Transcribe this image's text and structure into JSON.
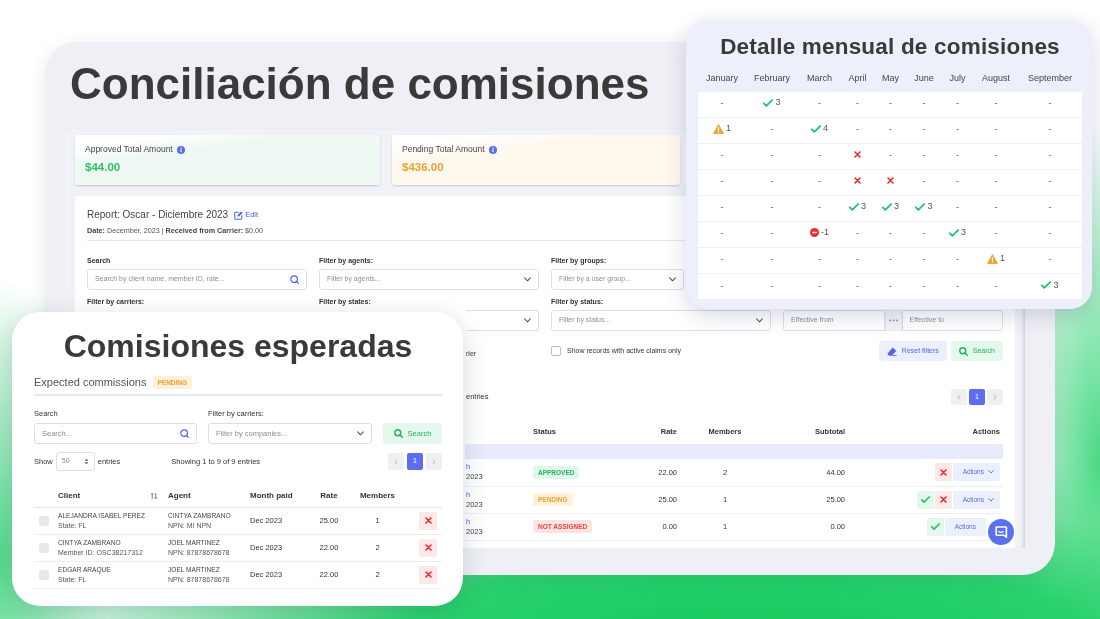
{
  "main_panel": {
    "title": "Conciliación de comisiones",
    "stat_cards": [
      {
        "label": "Approved Total Amount",
        "value": "$44.00",
        "kind": "approved"
      },
      {
        "label": "Pending Total Amount",
        "value": "$436.00",
        "kind": "pending"
      }
    ],
    "report": {
      "title": "Report: Oscar - Diciembre 2023",
      "edit_link": "Edit",
      "details": "**Date:** December, 2023 | **Received from Carrier:** $0.00"
    },
    "filter_rows": [
      [
        {
          "label": "Search",
          "kind": "search",
          "placeholder": "Search by client name, member ID, rate..."
        },
        {
          "label": "Filter by agents:",
          "kind": "select",
          "placeholder": "Filter by agents..."
        },
        {
          "label": "Filter by groups:",
          "kind": "select",
          "placeholder": "Filter by a user group..."
        }
      ],
      [
        {
          "label": "Filter by carriers:"
        },
        {
          "label": "Filter by states:",
          "kind": "select"
        },
        {
          "label": "Filter by status:",
          "kind": "select",
          "placeholder": "Filter by status..."
        },
        {
          "kind": "date_range",
          "from_placeholder": "Effective from",
          "to_placeholder": "Effective to"
        }
      ]
    ],
    "cut_option_label": "rier",
    "claims_checkbox": {
      "label": "Show records with active claims only",
      "checked": false
    },
    "buttons": [
      {
        "label": "Reset filters",
        "kind": "reset"
      },
      {
        "label": "Search",
        "kind": "search"
      }
    ],
    "cut_entries_text": "entries",
    "pages": [
      {
        "label": "1",
        "selected": true
      }
    ],
    "table": {
      "columns": [
        "Status",
        "Rate",
        "Members",
        "Subtotal",
        "Actions"
      ],
      "rows": [
        {
          "cut_client": "h",
          "cut_date": "2023",
          "status": {
            "label": "APPROVED",
            "kind": "approved"
          },
          "rate": "22.00",
          "members": "2",
          "subtotal": "44.00",
          "actions": [
            {
              "kind": "reject"
            }
          ],
          "menu": {
            "label": "Actions",
            "caret": true
          }
        },
        {
          "cut_client": "h",
          "cut_date": "2023",
          "status": {
            "label": "PENDING",
            "kind": "pending"
          },
          "rate": "25.00",
          "members": "1",
          "subtotal": "25.00",
          "actions": [
            {
              "kind": "approve"
            },
            {
              "kind": "reject"
            }
          ],
          "menu": {
            "label": "Actions",
            "caret": true
          }
        },
        {
          "cut_client": "h",
          "cut_date": "2023",
          "status": {
            "label": "NOT ASSIGNED",
            "kind": "not_assigned"
          },
          "rate": "0.00",
          "members": "1",
          "subtotal": "0.00",
          "actions": [
            {
              "kind": "approve"
            }
          ],
          "menu": {
            "label": "Actions",
            "caret": false
          }
        }
      ]
    }
  },
  "monthly_panel": {
    "title": "Detalle mensual de comisiones",
    "months": [
      "January",
      "February",
      "March",
      "April",
      "May",
      "June",
      "July",
      "August",
      "September"
    ],
    "rows": [
      [
        {
          "kind": "none",
          "text": "-"
        },
        {
          "kind": "check",
          "text": "3"
        },
        {
          "kind": "none",
          "text": "-"
        },
        {
          "kind": "none",
          "text": "-"
        },
        {
          "kind": "none",
          "text": "-"
        },
        {
          "kind": "none",
          "text": "-"
        },
        {
          "kind": "none",
          "text": "-"
        },
        {
          "kind": "none",
          "text": "-"
        },
        {
          "kind": "none",
          "text": "-"
        }
      ],
      [
        {
          "kind": "warning",
          "text": "1"
        },
        {
          "kind": "none",
          "text": "-"
        },
        {
          "kind": "check",
          "text": "4"
        },
        {
          "kind": "none",
          "text": "-"
        },
        {
          "kind": "none",
          "text": "-"
        },
        {
          "kind": "none",
          "text": "-"
        },
        {
          "kind": "none",
          "text": "-"
        },
        {
          "kind": "none",
          "text": "-"
        },
        {
          "kind": "none",
          "text": "-"
        }
      ],
      [
        {
          "kind": "none",
          "text": "-"
        },
        {
          "kind": "none",
          "text": "-"
        },
        {
          "kind": "none",
          "text": "-"
        },
        {
          "kind": "cross"
        },
        {
          "kind": "none",
          "text": "-"
        },
        {
          "kind": "none",
          "text": "-"
        },
        {
          "kind": "none",
          "text": "-"
        },
        {
          "kind": "none",
          "text": "-"
        },
        {
          "kind": "none",
          "text": "-"
        }
      ],
      [
        {
          "kind": "none",
          "text": "-"
        },
        {
          "kind": "none",
          "text": "-"
        },
        {
          "kind": "none",
          "text": "-"
        },
        {
          "kind": "cross"
        },
        {
          "kind": "cross"
        },
        {
          "kind": "none",
          "text": "-"
        },
        {
          "kind": "none",
          "text": "-"
        },
        {
          "kind": "none",
          "text": "-"
        },
        {
          "kind": "none",
          "text": "-"
        }
      ],
      [
        {
          "kind": "none",
          "text": "-"
        },
        {
          "kind": "none",
          "text": "-"
        },
        {
          "kind": "none",
          "text": "-"
        },
        {
          "kind": "check",
          "text": "3"
        },
        {
          "kind": "check",
          "text": "3"
        },
        {
          "kind": "check",
          "text": "3"
        },
        {
          "kind": "none",
          "text": "-"
        },
        {
          "kind": "none",
          "text": "-"
        },
        {
          "kind": "none",
          "text": "-"
        }
      ],
      [
        {
          "kind": "none",
          "text": "-"
        },
        {
          "kind": "none",
          "text": "-"
        },
        {
          "kind": "minus",
          "text": "-1"
        },
        {
          "kind": "none",
          "text": "-"
        },
        {
          "kind": "none",
          "text": "-"
        },
        {
          "kind": "none",
          "text": "-"
        },
        {
          "kind": "check",
          "text": "3"
        },
        {
          "kind": "none",
          "text": "-"
        },
        {
          "kind": "none",
          "text": "-"
        }
      ],
      [
        {
          "kind": "none",
          "text": "-"
        },
        {
          "kind": "none",
          "text": "-"
        },
        {
          "kind": "none",
          "text": "-"
        },
        {
          "kind": "none",
          "text": "-"
        },
        {
          "kind": "none",
          "text": "-"
        },
        {
          "kind": "none",
          "text": "-"
        },
        {
          "kind": "none",
          "text": "-"
        },
        {
          "kind": "warning",
          "text": "1"
        },
        {
          "kind": "none",
          "text": "-"
        }
      ],
      [
        {
          "kind": "none",
          "text": "-"
        },
        {
          "kind": "none",
          "text": "-"
        },
        {
          "kind": "none",
          "text": "-"
        },
        {
          "kind": "none",
          "text": "-"
        },
        {
          "kind": "none",
          "text": "-"
        },
        {
          "kind": "none",
          "text": "-"
        },
        {
          "kind": "none",
          "text": "-"
        },
        {
          "kind": "none",
          "text": "-"
        },
        {
          "kind": "check",
          "text": "3"
        }
      ]
    ]
  },
  "expected_panel": {
    "title": "Comisiones esperadas",
    "heading": "Expected commissions",
    "badge": {
      "label": "PENDING",
      "kind": "pending"
    },
    "search": {
      "label": "Search",
      "placeholder": "Search..."
    },
    "carrier_filter": {
      "label": "Filter by carriers:",
      "placeholder": "Filter by companies..."
    },
    "search_button": "Search",
    "length": {
      "before": "Show",
      "value": "50",
      "after": "entries"
    },
    "info": "Showing 1 to 9 of 9 entries",
    "pages": [
      {
        "label": "1",
        "selected": true
      }
    ],
    "table": {
      "columns": [
        "Client",
        "Agent",
        "Month paid",
        "Rate",
        "Members"
      ],
      "rows": [
        {
          "checked": false,
          "client": "ALEJANDRA ISABEL PEREZ",
          "client_detail": "State: FL",
          "agent": "CINTYA ZAMBRANO",
          "agent_detail": "NPN: MI NPN",
          "month": "Dec 2023",
          "rate": "25.00",
          "members": "1"
        },
        {
          "checked": false,
          "client": "CINTYA ZAMBRANO",
          "client_detail": "Member ID: OSC38217312",
          "agent": "JOEL MARTINEZ",
          "agent_detail": "NPN: 87878678678",
          "month": "Dec 2023",
          "rate": "22.00",
          "members": "2"
        },
        {
          "checked": false,
          "client": "EDGAR ARAQUE",
          "client_detail": "State: FL",
          "agent": "JOEL MARTINEZ",
          "agent_detail": "NPN: 87878678678",
          "month": "Dec 2023",
          "rate": "22.00",
          "members": "2"
        }
      ]
    }
  }
}
